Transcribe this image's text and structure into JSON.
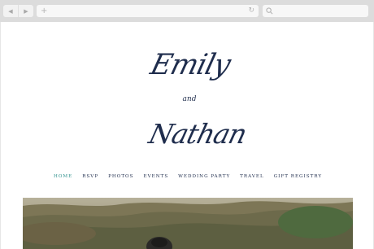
{
  "browser": {
    "back_icon": "◀",
    "forward_icon": "▶",
    "new_tab_icon": "+",
    "reload_icon": "↻"
  },
  "monogram": {
    "name_one": "Emily",
    "connector": "and",
    "name_two": "Nathan"
  },
  "nav": {
    "items": [
      {
        "label": "HOME",
        "active": true
      },
      {
        "label": "RSVP"
      },
      {
        "label": "PHOTOS"
      },
      {
        "label": "EVENTS"
      },
      {
        "label": "WEDDING PARTY"
      },
      {
        "label": "TRAVEL"
      },
      {
        "label": "GIFT REGISTRY"
      }
    ]
  },
  "colors": {
    "ink": "#1f2d4d",
    "accent": "#2a8e8a",
    "chrome": "#dcdcdc"
  }
}
